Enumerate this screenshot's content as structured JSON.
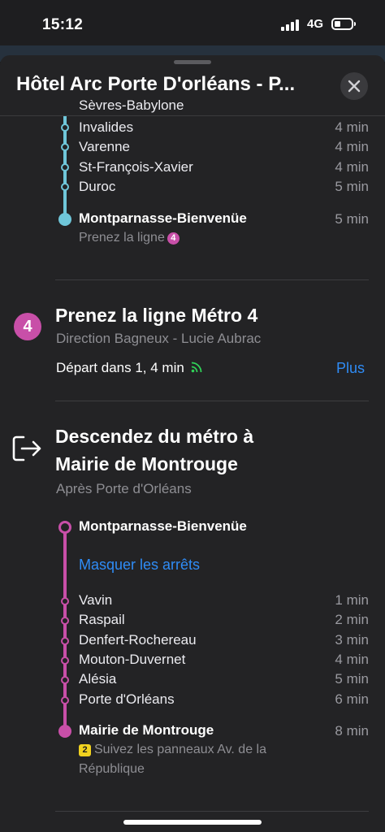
{
  "status": {
    "time": "15:12",
    "network": "4G"
  },
  "header": {
    "title": "Hôtel Arc Porte D'orléans - P..."
  },
  "colors": {
    "line_cyan": "#6fc6d9",
    "line_pink": "#c84fa8",
    "link_blue": "#2f8cf6",
    "live_green": "#30d158"
  },
  "segment1": {
    "partial_stop": "Sèvres-Babylone",
    "stops": [
      {
        "name": "Invalides",
        "time": "4 min"
      },
      {
        "name": "Varenne",
        "time": "4 min"
      },
      {
        "name": "St-François-Xavier",
        "time": "4 min"
      },
      {
        "name": "Duroc",
        "time": "5 min"
      }
    ],
    "end": {
      "name": "Montparnasse-Bienvenüe",
      "time": "5 min",
      "hint": "Prenez la ligne",
      "hint_badge": "4"
    }
  },
  "step_take": {
    "badge": "4",
    "title": "Prenez la ligne Métro 4",
    "direction": "Direction Bagneux - Lucie Aubrac",
    "departure": "Départ dans 1, 4 min",
    "more": "Plus"
  },
  "step_exit": {
    "title_line1": "Descendez du métro à",
    "title_line2": "Mairie de Montrouge",
    "after": "Après Porte d'Orléans",
    "start": "Montparnasse-Bienvenüe",
    "hide_stops": "Masquer les arrêts",
    "stops": [
      {
        "name": "Vavin",
        "time": "1 min"
      },
      {
        "name": "Raspail",
        "time": "2 min"
      },
      {
        "name": "Denfert-Rochereau",
        "time": "3 min"
      },
      {
        "name": "Mouton-Duvernet",
        "time": "4 min"
      },
      {
        "name": "Alésia",
        "time": "5 min"
      },
      {
        "name": "Porte d'Orléans",
        "time": "6 min"
      }
    ],
    "end": {
      "name": "Mairie de Montrouge",
      "time": "8 min",
      "exit_badge": "2",
      "hint_line1": "Suivez les panneaux Av. de la",
      "hint_line2": "République"
    }
  }
}
